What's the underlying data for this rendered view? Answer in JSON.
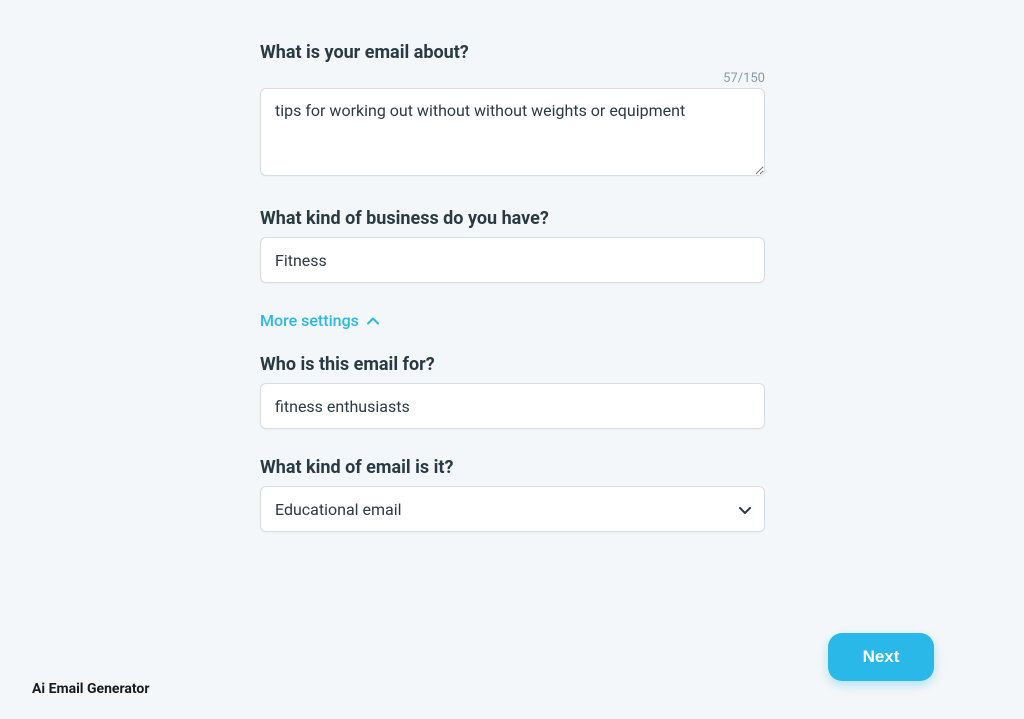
{
  "form": {
    "email_about": {
      "label": "What is your email about?",
      "value": "tips for working out without without weights or equipment",
      "counter": "57/150"
    },
    "business": {
      "label": "What kind of business do you have?",
      "value": "Fitness"
    },
    "more_settings_label": "More settings",
    "audience": {
      "label": "Who is this email for?",
      "value": "fitness enthusiasts"
    },
    "email_kind": {
      "label": "What kind of email is it?",
      "selected": "Educational email"
    }
  },
  "next_button_label": "Next",
  "footer_label": "Ai Email Generator"
}
